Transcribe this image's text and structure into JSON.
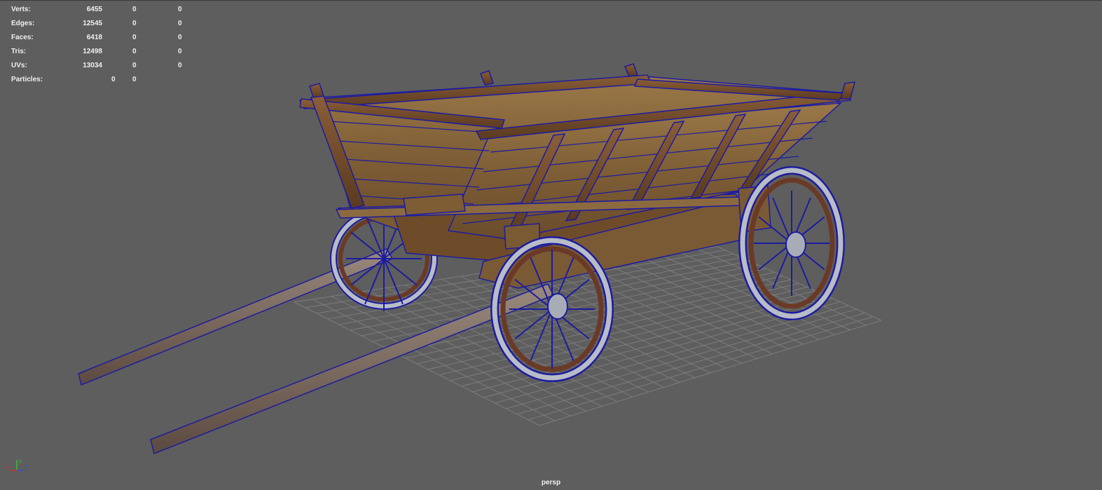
{
  "hud": {
    "rows": [
      {
        "label": "Verts:",
        "v1": "6455",
        "v2": "0",
        "v3": "0"
      },
      {
        "label": "Edges:",
        "v1": "12545",
        "v2": "0",
        "v3": "0"
      },
      {
        "label": "Faces:",
        "v1": "6418",
        "v2": "0",
        "v3": "0"
      },
      {
        "label": "Tris:",
        "v1": "12498",
        "v2": "0",
        "v3": "0"
      },
      {
        "label": "UVs:",
        "v1": "13034",
        "v2": "0",
        "v3": "0"
      }
    ],
    "particles": {
      "label": "Particles:",
      "v1": "0",
      "v2": "0"
    }
  },
  "camera": {
    "name": "persp"
  },
  "axis_labels": {
    "x": "x",
    "y": "y",
    "z": "z"
  },
  "colors": {
    "background": "#5e5e5e",
    "grid": "#7a7a7a",
    "wire": "#1c1ca0",
    "wood": "#6e4a2a",
    "plank": "#8a6a40",
    "iron": "#b0b4bc",
    "axis_x": "#d03030",
    "axis_y": "#30c030",
    "axis_z": "#3050e0"
  }
}
